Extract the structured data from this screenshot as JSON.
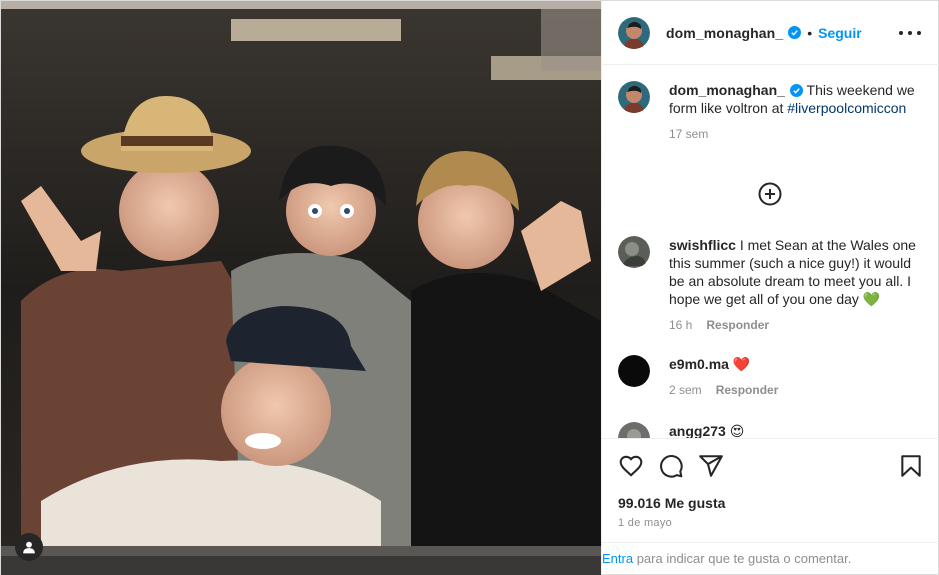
{
  "post": {
    "author": "dom_monaghan_",
    "follow_label": "Seguir",
    "separator": "•",
    "caption": {
      "author": "dom_monaghan_",
      "text": "This weekend we form like voltron at",
      "hashtag": "#liverpoolcomiccon",
      "time": "17 sem"
    },
    "comments": [
      {
        "user": "swishflicc",
        "text": "I met Sean at the Wales one this summer (such a nice guy!) it would be an absolute dream to meet you all. I hope we get all of you one day",
        "emoji": "💚",
        "time": "16 h",
        "reply_label": "Responder"
      },
      {
        "user": "e9m0.ma",
        "text": "",
        "emoji": "❤️",
        "time": "2 sem",
        "reply_label": "Responder"
      },
      {
        "user": "angg273",
        "text": "",
        "emoji": "😍",
        "time": "",
        "reply_label": ""
      }
    ],
    "likes": "99.016 Me gusta",
    "date": "1 de mayo",
    "composer": {
      "enter": "Entra",
      "rest": " para indicar que te gusta o comentar."
    }
  },
  "colors": {
    "accent": "#0095f6",
    "hashtag": "#00376b",
    "secondary_text": "#8e8e8e",
    "verified": "#0095f6"
  },
  "icons": [
    "verified-badge-icon",
    "more-options-icon",
    "load-more-comments-icon",
    "heart-icon",
    "comment-icon",
    "share-icon",
    "save-bookmark-icon",
    "tagged-users-icon"
  ]
}
